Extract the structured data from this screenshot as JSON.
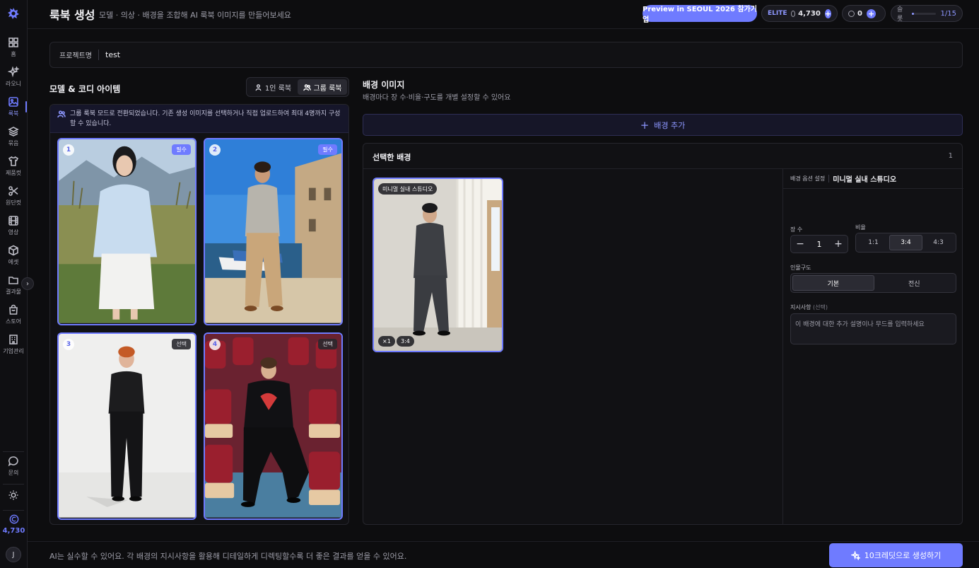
{
  "sidebar": {
    "items": [
      {
        "label": "홈",
        "icon": "grid-icon"
      },
      {
        "label": "라오니",
        "icon": "sparkle-icon"
      },
      {
        "label": "룩북",
        "icon": "image-icon"
      },
      {
        "label": "묶음",
        "icon": "layers-icon"
      },
      {
        "label": "제품컷",
        "icon": "shirt-icon"
      },
      {
        "label": "원단컷",
        "icon": "scissors-icon"
      },
      {
        "label": "영상",
        "icon": "film-icon"
      },
      {
        "label": "에셋",
        "icon": "cube-icon"
      },
      {
        "label": "결과물",
        "icon": "folder-icon"
      },
      {
        "label": "스토어",
        "icon": "bag-icon"
      },
      {
        "label": "기업관리",
        "icon": "building-icon"
      }
    ],
    "inquiry_label": "문의",
    "credits": "4,730",
    "avatar_initial": "J"
  },
  "header": {
    "title": "룩북 생성",
    "subtitle": "모델 · 의상 · 배경을 조합해 AI 룩북 이미지를 만들어보세요",
    "preview_button": "Preview in SEOUL 2026 참가기업",
    "plan": "ELITE",
    "credits": "4,730",
    "secondary_credits": "0",
    "slot_label": "슬롯",
    "slot_count": "1/15",
    "slot_fraction": 0.067
  },
  "project": {
    "label": "프로젝트명",
    "value": "test"
  },
  "models": {
    "title": "모델 & 코디 아이템",
    "mode_single": "1인 룩북",
    "mode_group": "그룹 룩북",
    "info": "그룹 룩북 모드로 전환되었습니다. 기존 생성 이미지를 선택하거나 직접 업로드하여 최대 4명까지 구성할 수 있습니다.",
    "cards": [
      {
        "num": "1",
        "badge": "필수"
      },
      {
        "num": "2",
        "badge": "필수"
      },
      {
        "num": "3",
        "badge": "선택"
      },
      {
        "num": "4",
        "badge": "선택"
      }
    ]
  },
  "background": {
    "title": "배경 이미지",
    "subtitle": "배경마다 장 수·비율·구도를 개별 설정할 수 있어요",
    "add_label": "배경 추가",
    "selected_title": "선택한 배경",
    "selected_count": "1",
    "card_label": "미니멀 실내 스튜디오",
    "card_count_chip": "×1",
    "card_ratio_chip": "3:4"
  },
  "options": {
    "head_key": "배경 옵션 설정",
    "head_value": "미니멀 실내 스튜디오",
    "count_label": "장 수",
    "count_value": "1",
    "ratio_label": "비율",
    "ratios": [
      "1:1",
      "3:4",
      "4:3"
    ],
    "selected_ratio": "3:4",
    "composition_label": "인물구도",
    "compositions": [
      "기본",
      "전신"
    ],
    "selected_composition": "기본",
    "instruction_label": "지시사항",
    "instruction_optional": "(선택)",
    "instruction_placeholder": "이 배경에 대한 추가 설명이나 무드를 입력하세요"
  },
  "footer": {
    "note": "AI는 실수할 수 있어요. 각 배경의 지시사항을 활용해 디테일하게 디렉팅할수록 더 좋은 결과를 얻을 수 있어요.",
    "generate_label": "10크레딧으로 생성하기"
  },
  "colors": {
    "accent": "#6f7bff",
    "background": "#0d0d0f",
    "panel": "#111114"
  }
}
